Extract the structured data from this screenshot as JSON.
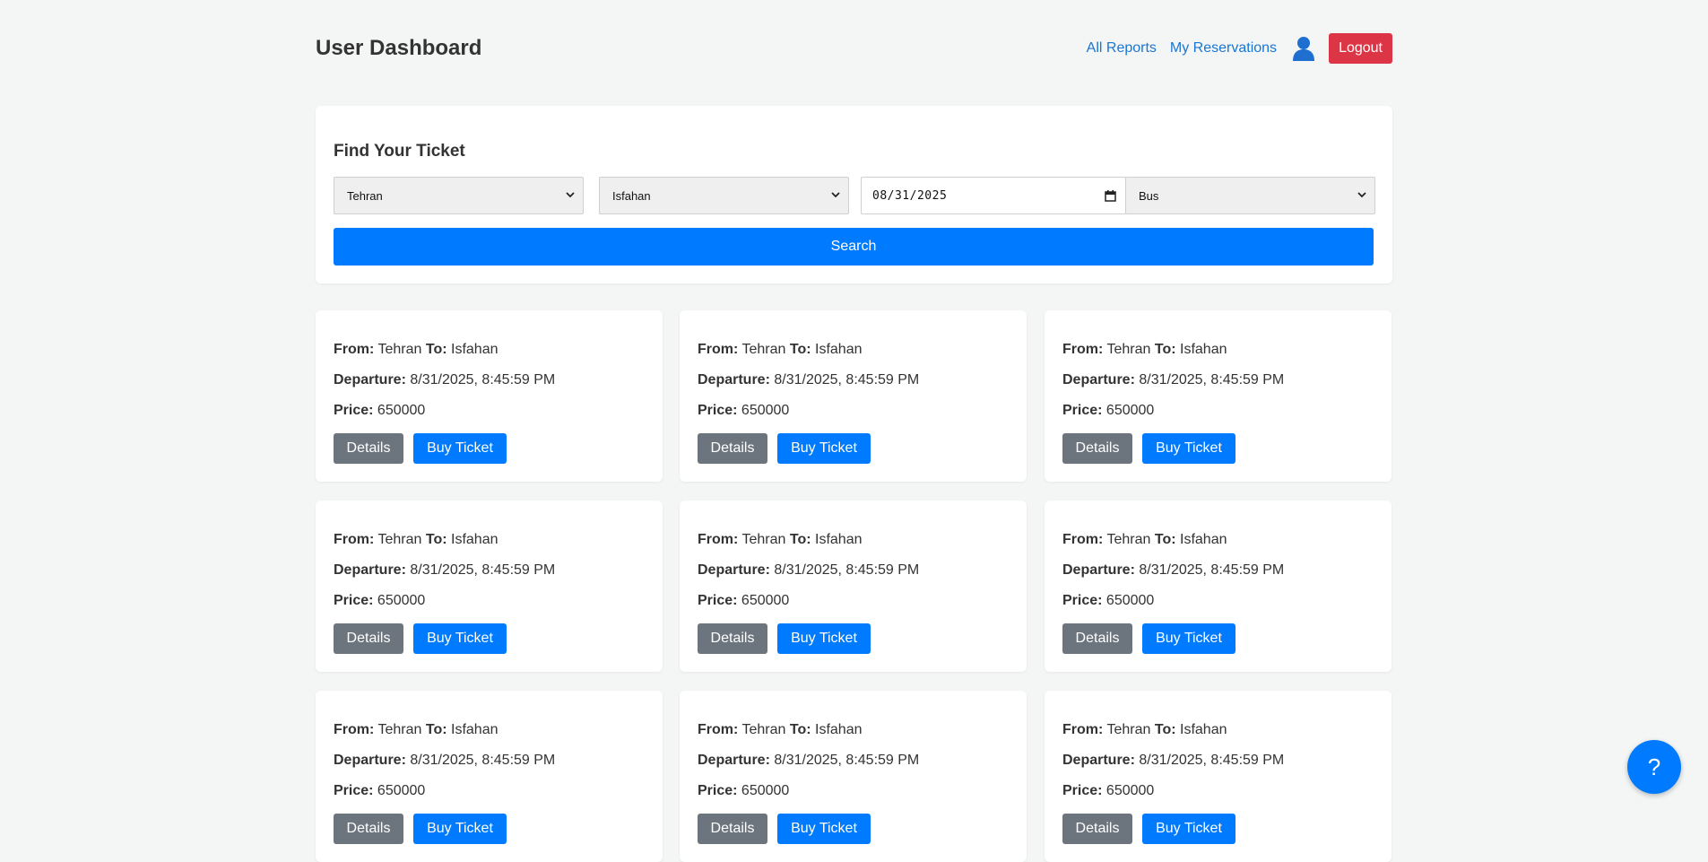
{
  "header": {
    "title": "User Dashboard",
    "nav_all_reports": "All Reports",
    "nav_my_reservations": "My Reservations",
    "logout_label": "Logout"
  },
  "search": {
    "title": "Find Your Ticket",
    "origin": "Tehran",
    "destination": "Isfahan",
    "date": "08/31/2025",
    "vehicle": "Bus",
    "button_label": "Search"
  },
  "labels": {
    "from": "From:",
    "to": "To:",
    "departure": "Departure:",
    "price": "Price:",
    "details": "Details",
    "buy": "Buy Ticket"
  },
  "tickets": [
    {
      "from": "Tehran",
      "to": "Isfahan",
      "departure": "8/31/2025, 8:45:59 PM",
      "price": "650000"
    },
    {
      "from": "Tehran",
      "to": "Isfahan",
      "departure": "8/31/2025, 8:45:59 PM",
      "price": "650000"
    },
    {
      "from": "Tehran",
      "to": "Isfahan",
      "departure": "8/31/2025, 8:45:59 PM",
      "price": "650000"
    },
    {
      "from": "Tehran",
      "to": "Isfahan",
      "departure": "8/31/2025, 8:45:59 PM",
      "price": "650000"
    },
    {
      "from": "Tehran",
      "to": "Isfahan",
      "departure": "8/31/2025, 8:45:59 PM",
      "price": "650000"
    },
    {
      "from": "Tehran",
      "to": "Isfahan",
      "departure": "8/31/2025, 8:45:59 PM",
      "price": "650000"
    },
    {
      "from": "Tehran",
      "to": "Isfahan",
      "departure": "8/31/2025, 8:45:59 PM",
      "price": "650000"
    },
    {
      "from": "Tehran",
      "to": "Isfahan",
      "departure": "8/31/2025, 8:45:59 PM",
      "price": "650000"
    },
    {
      "from": "Tehran",
      "to": "Isfahan",
      "departure": "8/31/2025, 8:45:59 PM",
      "price": "650000"
    }
  ],
  "help": {
    "label": "?"
  },
  "colors": {
    "primary": "#007bff",
    "danger": "#dc3545",
    "secondary": "#6c757d",
    "link": "#1976d2",
    "background": "#f4f6f6"
  },
  "icons": {
    "user": "user-icon",
    "select": "chevron-down-icon",
    "calendar": "calendar-icon"
  }
}
